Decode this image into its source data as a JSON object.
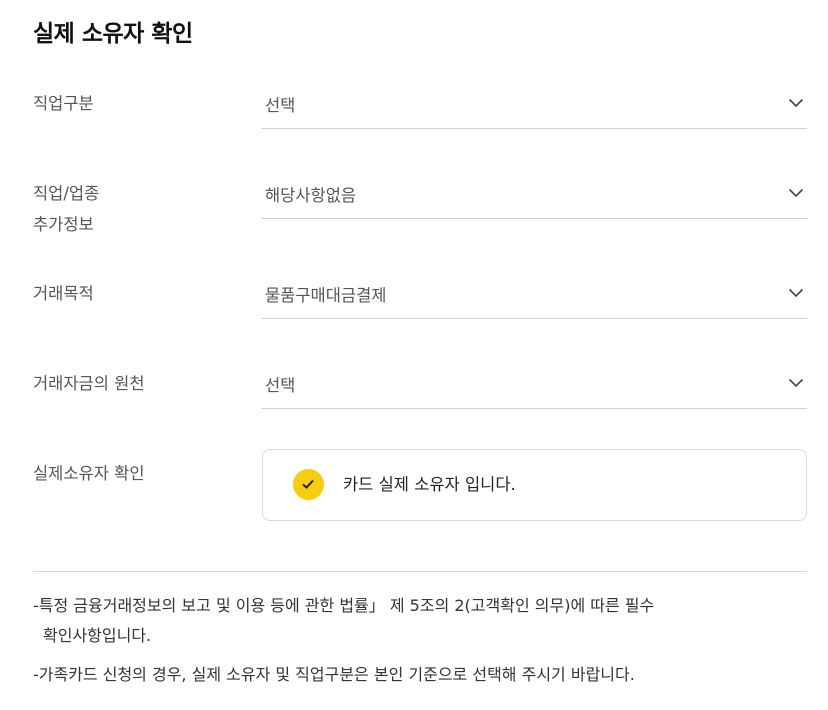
{
  "page": {
    "title": "실제 소유자 확인"
  },
  "form": {
    "fields": [
      {
        "label": "직업구분",
        "value": "선택"
      },
      {
        "label_line1": "직업/업종",
        "label_line2": "추가정보",
        "value": "해당사항없음"
      },
      {
        "label": "거래목적",
        "value": "물품구매대금결제"
      },
      {
        "label": "거래자금의 원천",
        "value": "선택"
      }
    ],
    "owner_confirm": {
      "label": "실제소유자 확인",
      "checkbox_text": "카드 실제 소유자 입니다.",
      "checked": true,
      "check_color": "#f7cc11"
    }
  },
  "notes": {
    "note1_line1": "-특정 금융거래정보의 보고 및 이용 등에 관한 법률」 제 5조의 2(고객확인 의무)에 따른 필수",
    "note1_line2": "확인사항입니다.",
    "note2": "-가족카드 신청의 경우, 실제 소유자 및 직업구분은 본인 기준으로 선택해 주시기 바랍니다."
  },
  "icons": {
    "dropdown": "chevron-down-icon",
    "check": "checkmark-icon"
  }
}
